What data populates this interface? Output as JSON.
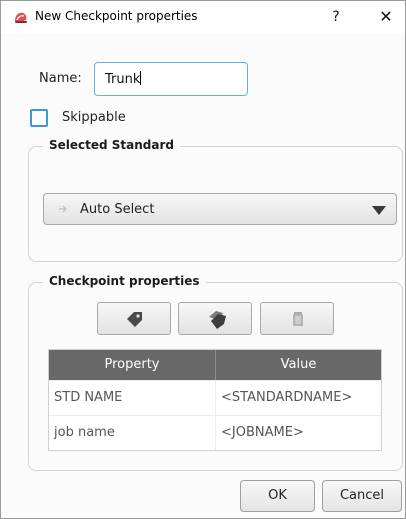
{
  "window": {
    "title": "New Checkpoint properties",
    "help_label": "?",
    "close_label": "✕"
  },
  "name": {
    "label": "Name:",
    "value": "Trunk"
  },
  "skippable": {
    "label": "Skippable",
    "checked": false
  },
  "selected_standard": {
    "group_title": "Selected Standard",
    "combo_value": "Auto Select"
  },
  "checkpoint_properties": {
    "group_title": "Checkpoint properties",
    "toolbar": [
      {
        "icon": "tag-icon"
      },
      {
        "icon": "tags-icon"
      },
      {
        "icon": "trash-icon"
      }
    ],
    "columns": [
      "Property",
      "Value"
    ],
    "rows": [
      [
        "STD NAME",
        "<STANDARDNAME>"
      ],
      [
        "job name",
        "<JOBNAME>"
      ]
    ]
  },
  "buttons": {
    "ok": "OK",
    "cancel": "Cancel"
  },
  "colors": {
    "accent": "#3f97d8",
    "table_header": "#686868"
  }
}
